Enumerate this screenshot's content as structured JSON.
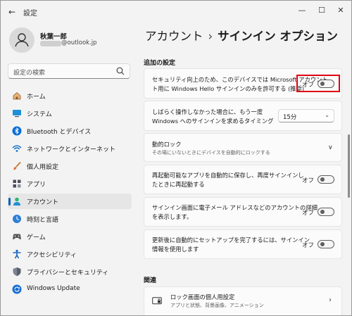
{
  "app": {
    "title": "設定"
  },
  "user": {
    "name": "秋葉一郎",
    "email_visible": "@outlook.jp"
  },
  "search": {
    "placeholder": "設定の検索"
  },
  "sidebar": {
    "items": [
      {
        "label": "ホーム",
        "icon": "home-icon"
      },
      {
        "label": "システム",
        "icon": "system-icon"
      },
      {
        "label": "Bluetooth とデバイス",
        "icon": "bluetooth-icon"
      },
      {
        "label": "ネットワークとインターネット",
        "icon": "wifi-icon"
      },
      {
        "label": "個人用設定",
        "icon": "brush-icon"
      },
      {
        "label": "アプリ",
        "icon": "apps-icon"
      },
      {
        "label": "アカウント",
        "icon": "account-icon",
        "active": true
      },
      {
        "label": "時刻と言語",
        "icon": "time-language-icon"
      },
      {
        "label": "ゲーム",
        "icon": "game-icon"
      },
      {
        "label": "アクセシビリティ",
        "icon": "accessibility-icon"
      },
      {
        "label": "プライバシーとセキュリティ",
        "icon": "shield-icon"
      },
      {
        "label": "Windows Update",
        "icon": "update-icon"
      }
    ]
  },
  "breadcrumb": {
    "parent": "アカウント",
    "separator": "›",
    "current": "サインイン オプション"
  },
  "sections": {
    "additional": "追加の設定",
    "related": "関連"
  },
  "settings": {
    "hello_only": {
      "line1": "セキュリティ向上のため、このデバイスでは Microsoft アカウント",
      "line2": "ト用に Windows Hello サインインのみを許可する (推奨)",
      "state": "オフ"
    },
    "away_signin": {
      "line1": "しばらく操作しなかった場合に、もう一度",
      "line2": "Windows へのサインインを求めるタイミング",
      "value": "15分"
    },
    "dynamic_lock": {
      "title": "動的ロック",
      "subtitle": "その場にいないときにデバイスを自動的にロックする"
    },
    "restart_apps": {
      "line1": "再起動可能なアプリを自動的に保存し、再度サインインし",
      "line2": "たときに再起動する",
      "state": "オフ"
    },
    "show_account_details": {
      "line1": "サインイン画面に電子メール アドレスなどのアカウントの詳細",
      "line2": "を表示します。",
      "state": "オフ"
    },
    "use_signin_info": {
      "line1": "更新後に自動的にセットアップを完了するには、サインイン",
      "line2": "情報を使用します",
      "state": "オフ"
    }
  },
  "related": {
    "lock_screen": {
      "title": "ロック画面の個人用設定",
      "subtitle": "アプリと状態、背景画像、アニメーション"
    }
  },
  "colors": {
    "accent": "#005fb8",
    "highlight": "#e00012"
  }
}
